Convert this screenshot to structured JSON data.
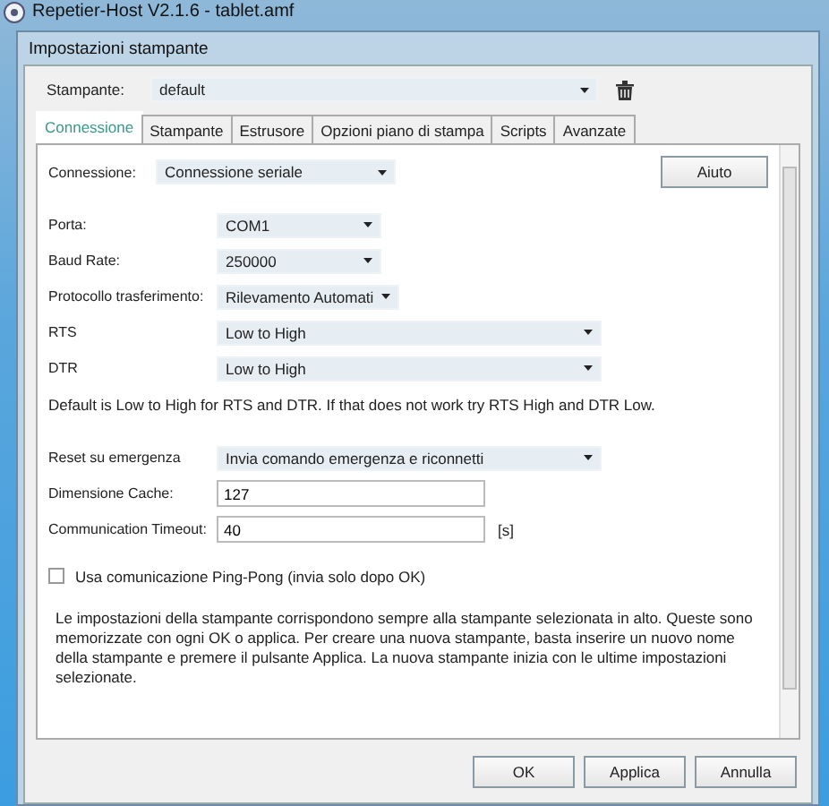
{
  "app_window": {
    "title": "Repetier-Host V2.1.6 - tablet.amf"
  },
  "dialog": {
    "title": "Impostazioni stampante"
  },
  "printer": {
    "label": "Stampante:",
    "value": "default"
  },
  "tabs": [
    {
      "label": "Connessione",
      "selected": true
    },
    {
      "label": "Stampante",
      "selected": false
    },
    {
      "label": "Estrusore",
      "selected": false
    },
    {
      "label": "Opzioni piano di stampa",
      "selected": false
    },
    {
      "label": "Scripts",
      "selected": false
    },
    {
      "label": "Avanzate",
      "selected": false
    }
  ],
  "connection": {
    "label": "Connessione:",
    "value": "Connessione seriale",
    "help_button": "Aiuto"
  },
  "fields": [
    {
      "kind": "combo",
      "label": "Porta:",
      "value": "COM1",
      "wide": false
    },
    {
      "kind": "combo",
      "label": "Baud Rate:",
      "value": "250000",
      "wide": false
    },
    {
      "kind": "combo",
      "label": "Protocollo trasferimento:",
      "value": "Rilevamento Automati",
      "wide": false
    },
    {
      "kind": "combo",
      "label": "RTS",
      "value": "Low to High",
      "wide": true
    },
    {
      "kind": "combo",
      "label": "DTR",
      "value": "Low to High",
      "wide": true
    },
    {
      "kind": "note",
      "text": "Default is Low to High for RTS and DTR. If that does not work try RTS High and DTR Low."
    },
    {
      "kind": "combo",
      "label": "Reset su emergenza",
      "value": "Invia comando emergenza e riconnetti",
      "wide": true
    },
    {
      "kind": "input",
      "label": "Dimensione Cache:",
      "value": "127"
    },
    {
      "kind": "input",
      "label": "Communication Timeout:",
      "value": "40",
      "unit": "[s]"
    },
    {
      "kind": "checkbox",
      "label": "Usa comunicazione Ping-Pong (invia solo dopo OK)",
      "checked": false
    },
    {
      "kind": "paragraph",
      "text": "Le impostazioni della stampante corrispondono sempre alla stampante selezionata in alto. Queste sono memorizzate con ogni OK o applica. Per creare una nuova stampante, basta inserire un nuovo nome della stampante e premere il pulsante Applica. La nuova stampante inizia con le ultime impostazioni selezionate."
    }
  ],
  "buttons": [
    "OK",
    "Applica",
    "Annulla"
  ]
}
